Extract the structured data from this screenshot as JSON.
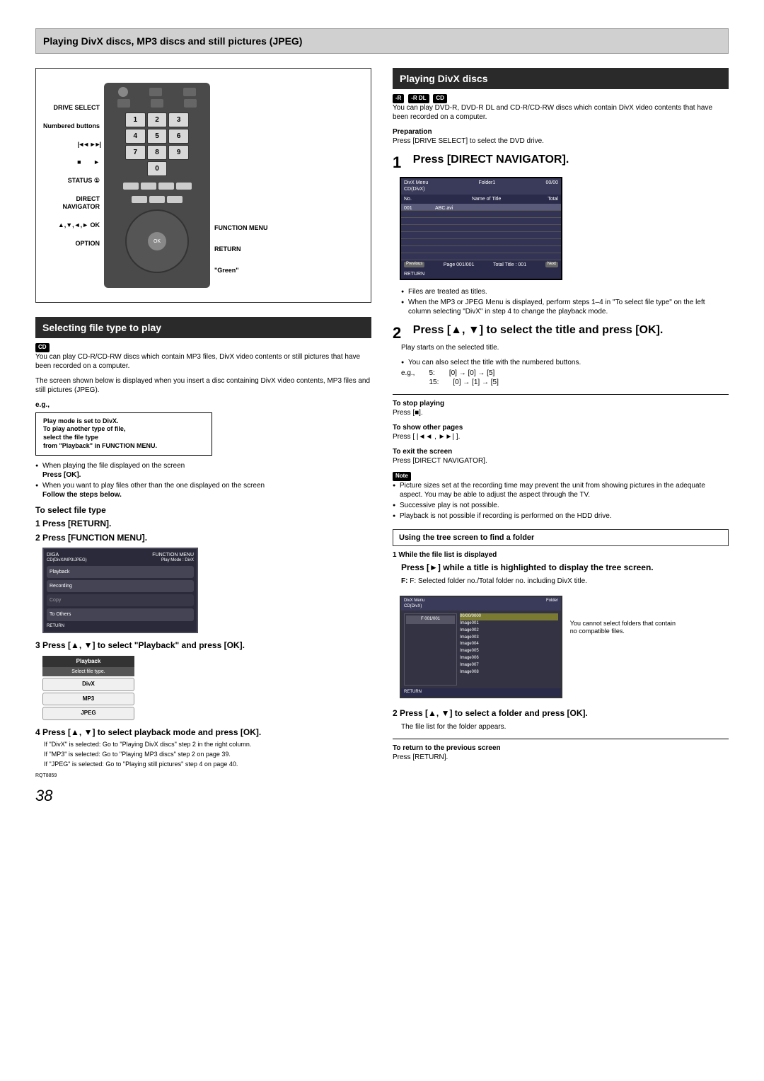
{
  "page_header": "Playing DivX discs, MP3 discs and still pictures (JPEG)",
  "remote": {
    "labels_left": [
      "DRIVE SELECT",
      "Numbered buttons",
      ",",
      "STATUS ①",
      "DIRECT NAVIGATOR",
      "▲,▼,◄,► OK",
      "OPTION"
    ],
    "labels_right": [
      "FUNCTION MENU",
      "RETURN",
      "\"Green\""
    ],
    "numpad": [
      "1",
      "2",
      "3",
      "4",
      "5",
      "6",
      "7",
      "8",
      "9",
      "0"
    ],
    "ok_label": "OK"
  },
  "left": {
    "section1_title": "Selecting file type to play",
    "badge_cd": "CD",
    "intro": "You can play CD-R/CD-RW discs which contain MP3 files, DivX video contents or still pictures that have been recorded on a computer.",
    "para2": "The screen shown below is displayed when you insert a disc containing DivX video contents, MP3 files and still pictures (JPEG).",
    "eg_label": "e.g.,",
    "eg_box": "Play mode is set to DivX.\nTo play another type of file,\nselect the file type\nfrom \"Playback\" in FUNCTION MENU.",
    "b1": "When playing the file displayed on the screen",
    "b1s": "Press [OK].",
    "b2": "When you want to play files other than the one displayed on the screen",
    "b2s": "Follow the steps below.",
    "sub1": "To select file type",
    "step1": "1   Press [RETURN].",
    "step2": "2   Press [FUNCTION MENU].",
    "funcmenu": {
      "brand": "DIGA",
      "title": "FUNCTION MENU",
      "disc": "CD(DivX/MP3/JPEG)",
      "mode": "Play Mode : DivX",
      "items": [
        "Playback",
        "Recording",
        "Copy",
        "To Others"
      ],
      "footer": "RETURN"
    },
    "step3": "3   Press [▲, ▼] to select \"Playback\" and press [OK].",
    "playback_box": {
      "head": "Playback",
      "sub": "Select file type.",
      "opts": [
        "DivX",
        "MP3",
        "JPEG"
      ]
    },
    "step4": "4   Press [▲, ▼] to select playback mode and press [OK].",
    "s4a": "If \"DivX\" is selected: Go to \"Playing DivX discs\" step 2 in the right column.",
    "s4b": "If \"MP3\" is selected:  Go to \"Playing MP3 discs\" step 2 on page 39.",
    "s4c": "If \"JPEG\" is selected: Go to \"Playing still pictures\" step 4 on page 40.",
    "doc_code": "RQT8859"
  },
  "right": {
    "section_title": "Playing DivX discs",
    "badges": [
      "-R",
      "-R DL",
      "CD"
    ],
    "intro": "You can play DVD-R, DVD-R DL and CD-R/CD-RW discs which contain DivX video contents that have been recorded on a computer.",
    "prep_head": "Preparation",
    "prep_text": "Press [DRIVE SELECT] to select the DVD drive.",
    "step1_head": "Press [DIRECT NAVIGATOR].",
    "osd": {
      "title_l": "DivX Menu",
      "sub_l": "CD(DivX)",
      "title_c": "Folder1",
      "title_r": "00/00",
      "cols": [
        "No.",
        "Name of Title",
        "Total"
      ],
      "row1_no": "001",
      "row1_name": "ABC.avi",
      "foot_page": "Page   001/001",
      "foot_total": "Total Title :  001",
      "prev": "Previous",
      "next": "Next",
      "return": "RETURN"
    },
    "b_files": "Files are treated as titles.",
    "b_when": "When the MP3 or JPEG Menu is displayed, perform steps 1–4 in \"To select file type\" on the left column selecting \"DivX\" in step 4 to change the playback mode.",
    "step2_head": "Press [▲, ▼] to select the title and press [OK].",
    "play_starts": "Play starts on the selected title.",
    "b_numbered": "You can also select the title with the numbered buttons.",
    "eg_lbl": "e.g.,",
    "eg_5": "5:",
    "eg_5v": "[0] → [0] → [5]",
    "eg_15": "15:",
    "eg_15v": "[0] → [1] → [5]",
    "stop_h": "To stop playing",
    "stop_t": "Press [■].",
    "pages_h": "To show other pages",
    "pages_t": "Press [ |◄◄ , ►►| ].",
    "exit_h": "To exit the screen",
    "exit_t": "Press [DIRECT NAVIGATOR].",
    "note_lbl": "Note",
    "note1": "Picture sizes set at the recording time may prevent the unit from showing pictures in the adequate aspect. You may be able to adjust the aspect through the TV.",
    "note2": "Successive play is not possible.",
    "note3": "Playback is not possible if recording is performed on the HDD drive.",
    "tree_title": "Using the tree screen to find a folder",
    "tree_s1a": "1   While the file list is displayed",
    "tree_s1b": "Press [►] while a title is highlighted to display the tree screen.",
    "tree_fnote": "F: Selected folder no./Total folder no. including DivX title.",
    "tree_osd": {
      "title_l": "DivX Menu",
      "sub_l": "CD(DivX)",
      "right": "Folder",
      "root": "F 001/001",
      "folders": [
        "00/00/0000",
        "Image001",
        "Image002",
        "Image003",
        "Image004",
        "Image005",
        "Image006",
        "Image007",
        "Image008"
      ],
      "return": "RETURN"
    },
    "tree_caption": "You cannot select folders that contain no compatible files.",
    "tree_s2": "2   Press [▲, ▼] to select a folder and press [OK].",
    "tree_s2t": "The file list for the folder appears.",
    "tree_ret_h": "To return to the previous screen",
    "tree_ret_t": "Press [RETURN]."
  },
  "page_number": "38"
}
